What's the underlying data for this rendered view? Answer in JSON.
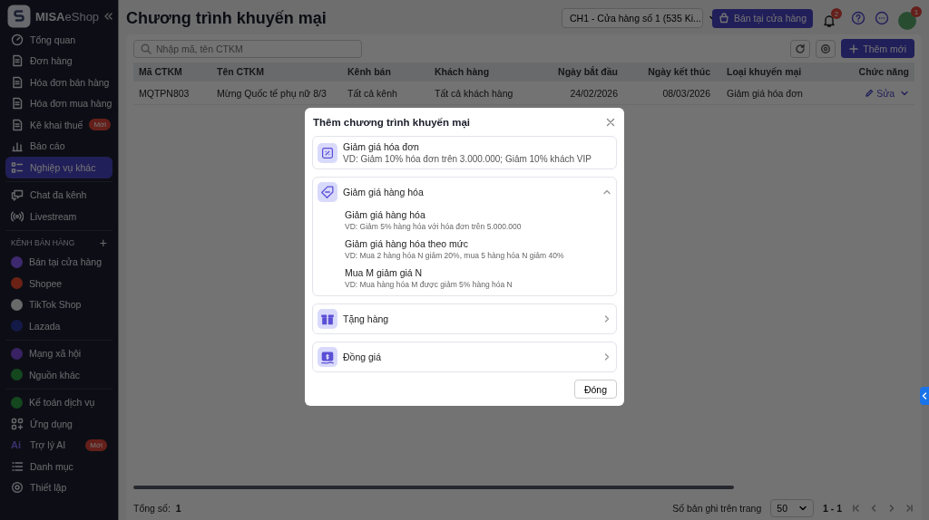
{
  "sidebar": {
    "logo_bold": "MISA",
    "logo_light": "eShop",
    "groups": [
      {
        "items": [
          {
            "label": "Tổng quan",
            "selected": false
          },
          {
            "label": "Đơn hàng",
            "selected": false
          },
          {
            "label": "Hóa đơn bán hàng",
            "selected": false
          },
          {
            "label": "Hóa đơn mua hàng",
            "selected": false
          },
          {
            "label": "Kê khai thuế",
            "selected": false,
            "badge": "Mới"
          },
          {
            "label": "Báo cáo",
            "selected": false
          },
          {
            "label": "Nghiệp vụ khác",
            "selected": true
          }
        ]
      },
      {
        "items": [
          {
            "label": "Chat đa kênh",
            "selected": false
          },
          {
            "label": "Livestream",
            "selected": false
          }
        ]
      },
      {
        "heading": "KÊNH BÁN HÀNG",
        "add": "+",
        "items": [
          {
            "label": "Bán tại cửa hàng",
            "selected": false
          },
          {
            "label": "Shopee",
            "selected": false
          },
          {
            "label": "TikTok Shop",
            "selected": false
          },
          {
            "label": "Lazada",
            "selected": false
          }
        ]
      },
      {
        "items": [
          {
            "label": "Mạng xã hội",
            "selected": false
          },
          {
            "label": "Nguồn khác",
            "selected": false
          }
        ]
      },
      {
        "items": [
          {
            "label": "Kế toán dịch vụ",
            "selected": false
          },
          {
            "label": "Ứng dụng",
            "selected": false
          },
          {
            "label": "Trợ lý AI",
            "selected": false,
            "badge": "Mới",
            "ai_mark": "Ai"
          },
          {
            "label": "Danh mục",
            "selected": false
          },
          {
            "label": "Thiết lập",
            "selected": false
          }
        ]
      }
    ]
  },
  "header": {
    "title": "Chương trình khuyến mại",
    "store_select": "CH1 - Cửa hàng số 1 (535 Ki...",
    "pos_button": "Bán tại cửa hàng",
    "notification_count": "2",
    "avatar_badge": "1"
  },
  "toolbar": {
    "search_placeholder": "Nhập mã, tên CTKM",
    "add_button": "Thêm mới"
  },
  "table": {
    "columns": [
      "Mã CTKM",
      "Tên CTKM",
      "Kênh bán",
      "Khách hàng",
      "Ngày bắt đầu",
      "Ngày kết thúc",
      "Loại khuyến mại",
      "Chức năng"
    ],
    "rows": [
      {
        "cells": [
          "MQTPN803",
          "Mừng Quốc tế phụ nữ 8/3",
          "Tất cả kênh",
          "Tất cả khách hàng",
          "24/02/2026",
          "08/03/2026",
          "Giảm giá hóa đơn"
        ],
        "action": "Sửa"
      }
    ]
  },
  "footer": {
    "total_label": "Tổng số:",
    "total": "1",
    "per_page_label": "Số bản ghi trên trang",
    "per_page": "50",
    "range": "1 - 1"
  },
  "modal": {
    "title": "Thêm chương trình khuyến mại",
    "options": [
      {
        "kind": "direct",
        "title": "Giảm giá hóa đơn",
        "description": "VD: Giảm 10% hóa đơn trên 3.000.000; Giảm 10% khách VIP"
      },
      {
        "kind": "group",
        "title": "Giảm giá hàng hóa",
        "expanded": true,
        "children": [
          {
            "title": "Giảm giá hàng hóa",
            "description": "VD: Giảm 5% hàng hóa với hóa đơn trên 5.000.000"
          },
          {
            "title": "Giảm giá hàng hóa theo mức",
            "description": "VD: Mua 2 hàng hóa N giảm 20%, mua 5 hàng hóa N giảm 40%"
          },
          {
            "title": "Mua M giảm giá N",
            "description": "VD: Mua hàng hóa M được giảm 5% hàng hóa N"
          }
        ]
      },
      {
        "kind": "group",
        "title": "Tặng hàng",
        "expanded": false
      },
      {
        "kind": "group",
        "title": "Đồng giá",
        "expanded": false
      }
    ],
    "close_button": "Đóng"
  }
}
